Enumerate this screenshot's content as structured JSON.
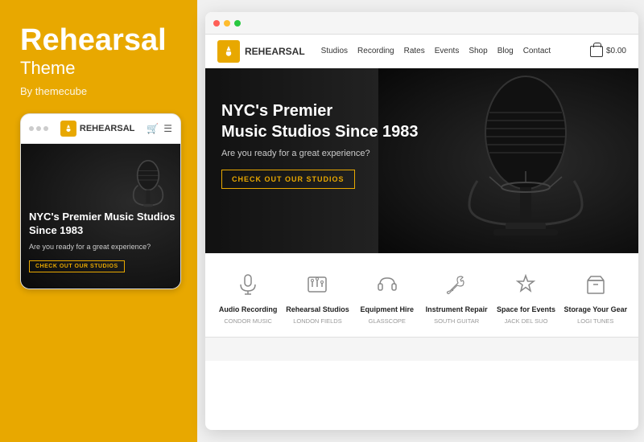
{
  "left": {
    "title": "Rehearsal",
    "subtitle": "Theme",
    "author": "By themecube",
    "mobile": {
      "logo": "REHEARSAL",
      "hero": {
        "heading": "NYC's Premier Music Studios Since 1983",
        "subtext": "Are you ready for a great experience?",
        "cta": "CHECK OUT OUR STUDIOS"
      }
    }
  },
  "browser": {
    "logo": "REHEARSAL",
    "nav": {
      "links": [
        "Studios",
        "Recording",
        "Rates",
        "Events",
        "Shop",
        "Blog",
        "Contact"
      ],
      "cart": "$0.00"
    },
    "hero": {
      "heading_line1": "NYC's Premier",
      "heading_line2": "Music Studios Since 1983",
      "subtext": "Are you ready for a great experience?",
      "cta": "CHECK OUT OUR STUDIOS"
    },
    "features": [
      {
        "icon": "microphone",
        "title": "Audio Recording",
        "subtitle": "CONDOR MUSIC"
      },
      {
        "icon": "mixer",
        "title": "Rehearsal Studios",
        "subtitle": "LONDON FIELDS"
      },
      {
        "icon": "headphones",
        "title": "Equipment Hire",
        "subtitle": "GLASSCOPE"
      },
      {
        "icon": "wrench",
        "title": "Instrument Repair",
        "subtitle": "SOUTH GUITAR"
      },
      {
        "icon": "star",
        "title": "Space for Events",
        "subtitle": "JACK DEL SUO"
      },
      {
        "icon": "box",
        "title": "Storage Your Gear",
        "subtitle": "LOGI TUNES"
      }
    ]
  }
}
